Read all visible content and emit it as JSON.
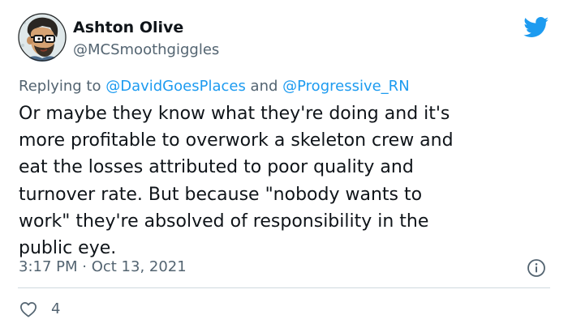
{
  "author": {
    "display_name": "Ashton Olive",
    "handle": "@MCSmoothgiggles",
    "avatar_icon": "cartoon-avatar"
  },
  "platform_icon": "twitter-bird-icon",
  "colors": {
    "accent": "#1d9bf0",
    "text": "#0f1419",
    "muted": "#536471",
    "divider": "#cfd9de"
  },
  "reply": {
    "prefix": "Replying to ",
    "mention_1": "@DavidGoesPlaces",
    "joiner": " and ",
    "mention_2": "@Progressive_RN"
  },
  "tweet": {
    "text": "Or maybe they know what they're doing and it's\nmore profitable to overwork a skeleton crew and\neat the losses attributed to poor quality and\nturnover rate. But because \"nobody wants to\nwork\" they're absolved of responsibility in the\npublic eye.",
    "timestamp": "3:17 PM · Oct 13, 2021"
  },
  "actions": {
    "like_count": "4",
    "like_icon": "heart-icon",
    "info_icon": "info-icon"
  }
}
